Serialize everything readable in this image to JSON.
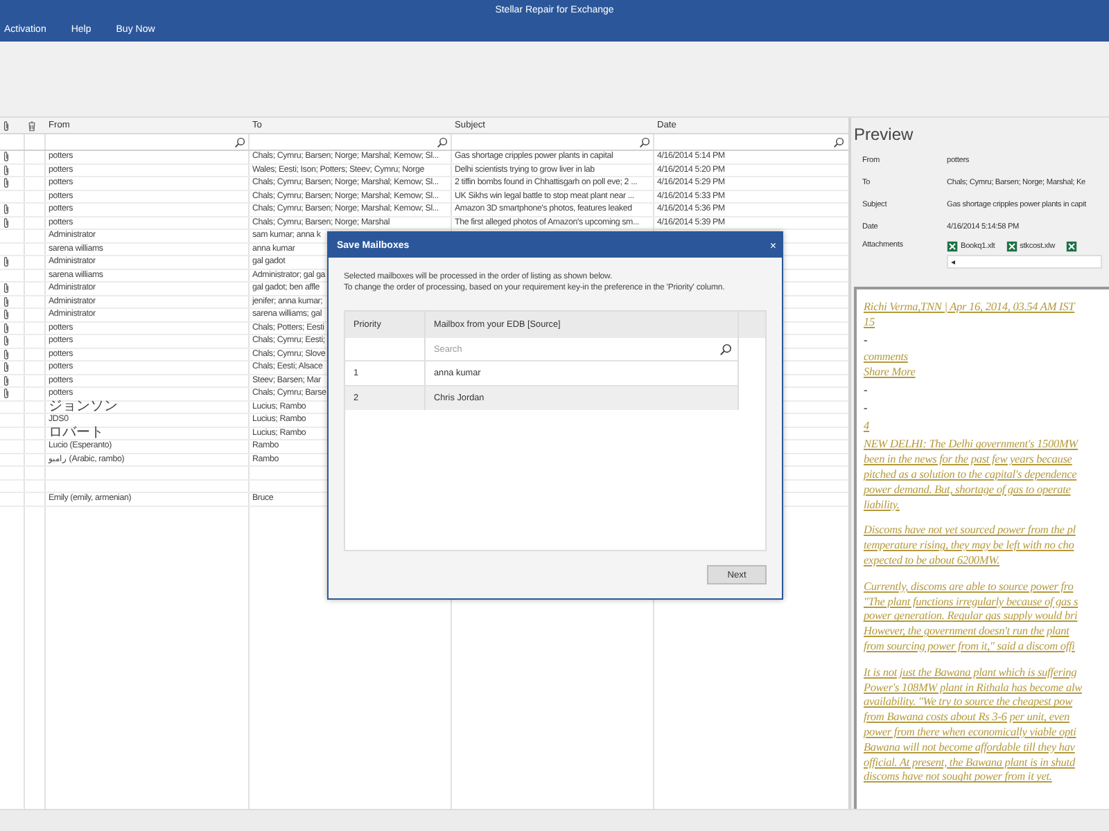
{
  "window": {
    "title": "Stellar Repair for Exchange"
  },
  "menu": [
    "Activation",
    "Help",
    "Buy Now"
  ],
  "table": {
    "columns": [
      "From",
      "To",
      "Subject",
      "Date"
    ],
    "rows": [
      {
        "attachment": true,
        "from": "potters",
        "to": "Chals; Cymru; Barsen; Norge; Marshal; Kemow; Sl...",
        "subject": "Gas shortage cripples power plants in capital",
        "date": "4/16/2014 5:14 PM"
      },
      {
        "attachment": true,
        "from": "potters",
        "to": "Wales; Eesti; Ison; Potters; Steev; Cymru; Norge",
        "subject": "Delhi scientists trying to grow liver in lab",
        "date": "4/16/2014 5:20 PM"
      },
      {
        "attachment": true,
        "from": "potters",
        "to": "Chals; Cymru; Barsen; Norge; Marshal; Kemow; Sl...",
        "subject": "2 tiffin bombs found in Chhattisgarh on poll eve; 2 ...",
        "date": "4/16/2014 5:29 PM"
      },
      {
        "attachment": false,
        "from": "potters",
        "to": "Chals; Cymru; Barsen; Norge; Marshal; Kemow; Sl...",
        "subject": "UK Sikhs win legal battle to stop meat plant near ...",
        "date": "4/16/2014 5:33 PM"
      },
      {
        "attachment": true,
        "from": "potters",
        "to": "Chals; Cymru; Barsen; Norge; Marshal; Kemow; Sl...",
        "subject": "Amazon 3D smartphone's photos, features leaked",
        "date": "4/16/2014 5:36 PM"
      },
      {
        "attachment": true,
        "from": "potters",
        "to": "Chals; Cymru; Barsen; Norge; Marshal",
        "subject": "The first alleged photos of Amazon's upcoming sm...",
        "date": "4/16/2014 5:39 PM"
      },
      {
        "attachment": false,
        "from": "Administrator",
        "to": "sam kumar; anna k"
      },
      {
        "attachment": false,
        "from": "sarena williams",
        "to": "anna kumar"
      },
      {
        "attachment": true,
        "from": "Administrator",
        "to": "gal gadot"
      },
      {
        "attachment": false,
        "from": "sarena williams",
        "to": "Administrator; gal ga"
      },
      {
        "attachment": true,
        "from": "Administrator",
        "to": "gal gadot; ben affle"
      },
      {
        "attachment": true,
        "from": "Administrator",
        "to": "jenifer; anna kumar;"
      },
      {
        "attachment": true,
        "from": "Administrator",
        "to": "sarena williams; gal"
      },
      {
        "attachment": true,
        "from": "potters",
        "to": "Chals; Potters; Eesti"
      },
      {
        "attachment": true,
        "from": "potters",
        "to": "Chals; Cymru; Eesti;"
      },
      {
        "attachment": true,
        "from": "potters",
        "to": "Chals; Cymru; Slove"
      },
      {
        "attachment": true,
        "from": "potters",
        "to": "Chals; Eesti; Alsace"
      },
      {
        "attachment": true,
        "from": "potters",
        "to": "Steev; Barsen; Mar"
      },
      {
        "attachment": true,
        "from": "potters",
        "to": "Chals; Cymru; Barse"
      },
      {
        "attachment": false,
        "from": "ジョンソン",
        "to": "Lucius; Rambo"
      },
      {
        "attachment": false,
        "from": "JDS0",
        "to": "Lucius; Rambo"
      },
      {
        "attachment": false,
        "from": "ロバート",
        "to": "Lucius; Rambo"
      },
      {
        "attachment": false,
        "from": "Lucio (Esperanto)",
        "to": "Rambo"
      },
      {
        "attachment": false,
        "from": "رامبو (Arabic, rambo)",
        "to": "Rambo"
      },
      {
        "attachment": false
      },
      {
        "attachment": false
      },
      {
        "attachment": false,
        "from": "Emily (emily, armenian)",
        "to": "Bruce"
      }
    ]
  },
  "dialog": {
    "title": "Save Mailboxes",
    "close": "×",
    "message": [
      "Selected mailboxes will be processed in the order of listing as shown below.",
      "To change the order of processing, based on your requirement key-in the preference in the 'Priority' column."
    ],
    "columns": [
      "Priority",
      "Mailbox from your EDB [Source]"
    ],
    "search": {
      "placeholder": "Search"
    },
    "rows": [
      {
        "priority": "1",
        "mailbox": "anna kumar"
      },
      {
        "priority": "2",
        "mailbox": "Chris Jordan"
      }
    ],
    "button": "Next"
  },
  "preview": {
    "title": "Preview",
    "fields": [
      {
        "label": "From",
        "value": "potters"
      },
      {
        "label": "To",
        "value": "Chals; Cymru; Barsen; Norge; Marshal; Ke"
      },
      {
        "label": "Subject",
        "value": "Gas shortage cripples power plants in capit"
      },
      {
        "label": "Date",
        "value": "4/16/2014 5:14:58 PM"
      }
    ],
    "attachments_label": "Attachments",
    "attachments": [
      "Bookq1.xlt",
      "stkcost.xlw"
    ],
    "scroll_arrow": "◂",
    "header": [
      {
        "kind": "link",
        "text": "Richi Verma,TNN | Apr 16, 2014, 03.54 AM IST"
      },
      {
        "kind": "link",
        "text": "15"
      },
      {
        "kind": "plain",
        "text": "-"
      },
      {
        "kind": "link",
        "text": "comments"
      },
      {
        "kind": "link",
        "text": "Share More"
      },
      {
        "kind": "plain",
        "text": "-"
      },
      {
        "kind": "plain",
        "text": "-"
      },
      {
        "kind": "link",
        "text": "4"
      }
    ],
    "paragraphs": [
      [
        "NEW DELHI: The Delhi government's 1500MW",
        "been in the news for the past few years because",
        "pitched as a solution to the capital's dependence",
        "power demand. But, shortage of gas to operate",
        "liability."
      ],
      [
        "Discoms have not yet sourced power from the pl",
        "temperature rising, they may be left with no cho",
        "expected to be about 6200MW."
      ],
      [
        "Currently, discoms are able to source power fro",
        "\"The plant functions irregularly because of gas s",
        "power generation. Regular gas supply would bri",
        "However, the government doesn't run the plant",
        "from sourcing power from it,\" said a discom offi"
      ],
      [
        "It is not just the Bawana plant which is suffering",
        "Power's 108MW plant in Rithala has become alw",
        "availability. \"We try to source the cheapest pow",
        "from Bawana costs about Rs 3-6 per unit, even",
        "power from there when economically viable opti",
        "Bawana will not become affordable till they hav",
        "official. At present, the Bawana plant is in shutd",
        "discoms have not sought power from it yet."
      ]
    ]
  }
}
